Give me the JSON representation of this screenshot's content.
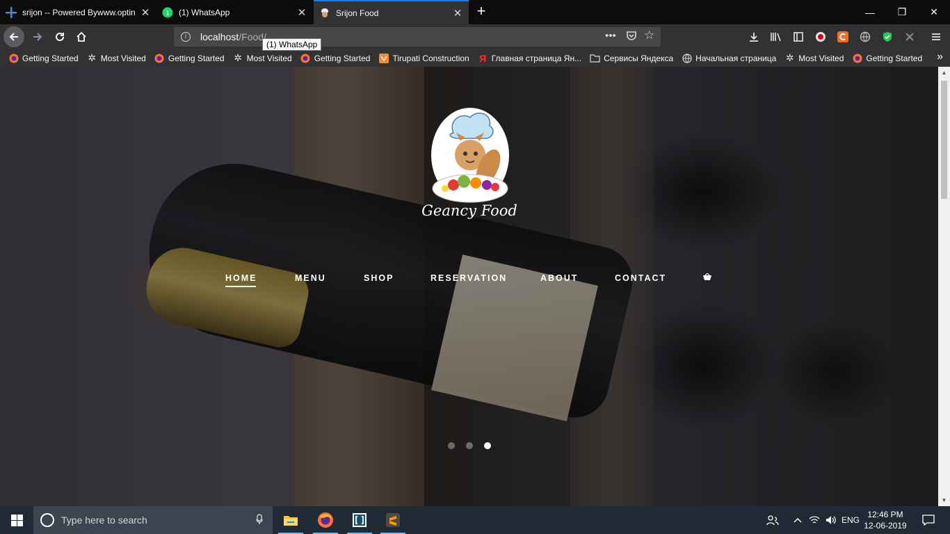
{
  "browser": {
    "tabs": [
      {
        "title": "srijon -- Powered Bywww.optin",
        "icon": "blue-cross-icon",
        "close": "✕"
      },
      {
        "title": "(1) WhatsApp",
        "icon": "whatsapp-icon",
        "close": "✕"
      },
      {
        "title": "Srijon Food",
        "icon": "chef-favicon-icon",
        "close": "✕",
        "active": true
      }
    ],
    "new_tab": "+",
    "window_controls": [
      "—",
      "❐",
      "✕"
    ],
    "url": {
      "host": "localhost",
      "path": "/Food/"
    },
    "tooltip": "(1) WhatsApp",
    "bookmarks": [
      {
        "label": "Getting Started",
        "icon": "firefox-icon"
      },
      {
        "label": "Most Visited",
        "icon": "gear-icon"
      },
      {
        "label": "Getting Started",
        "icon": "firefox-icon"
      },
      {
        "label": "Most Visited",
        "icon": "gear-icon"
      },
      {
        "label": "Getting Started",
        "icon": "firefox-icon"
      },
      {
        "label": "Tirupati Construction",
        "icon": "orange-site-icon"
      },
      {
        "label": "Главная страница Ян...",
        "icon": "yandex-icon"
      },
      {
        "label": "Сервисы Яндекса",
        "icon": "folder-icon"
      },
      {
        "label": "Начальная страница",
        "icon": "globe-icon"
      },
      {
        "label": "Most Visited",
        "icon": "gear-icon"
      },
      {
        "label": "Getting Started",
        "icon": "firefox-icon"
      }
    ],
    "bookmarks_more": "»"
  },
  "site": {
    "logo_text": "Geancy Food",
    "nav": [
      {
        "label": "HOME",
        "active": true
      },
      {
        "label": "MENU"
      },
      {
        "label": "SHOP"
      },
      {
        "label": "RESERVATION"
      },
      {
        "label": "ABOUT"
      },
      {
        "label": "CONTACT"
      }
    ],
    "cart_icon": "cart-icon",
    "slider": {
      "count": 3,
      "active_index": 2
    }
  },
  "taskbar": {
    "search_placeholder": "Type here to search",
    "apps": [
      "file-explorer-icon",
      "firefox-icon",
      "app-bracket-icon",
      "sublime-text-icon"
    ],
    "tray": {
      "lang": "ENG"
    },
    "clock": {
      "time": "12:46 PM",
      "date": "12-06-2019"
    }
  }
}
